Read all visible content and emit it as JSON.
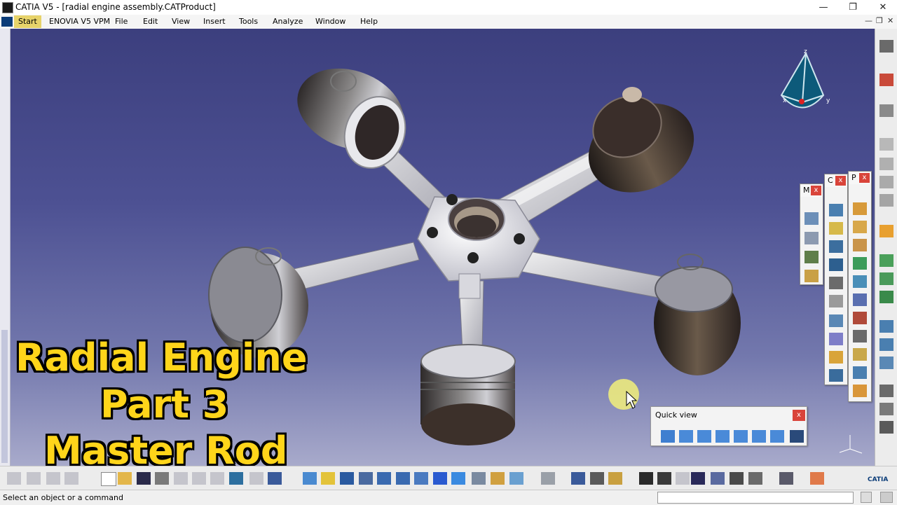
{
  "window": {
    "title": "CATIA V5 - [radial engine assembly.CATProduct]",
    "controls": [
      "—",
      "❐",
      "✕"
    ]
  },
  "menubar": {
    "start": "Start",
    "items": [
      "ENOVIA V5 VPM",
      "File",
      "Edit",
      "View",
      "Insert",
      "Tools",
      "Analyze",
      "Window",
      "Help"
    ]
  },
  "mdi_controls": [
    "—",
    "❐",
    "✕"
  ],
  "overlay": {
    "line1": "Radial Engine",
    "line2": "Part 3",
    "line3": "Master Rod"
  },
  "toolbars": {
    "m_label": "M",
    "c_label": "C",
    "p_label": "P",
    "close_glyph": "x"
  },
  "quickview": {
    "title": "Quick view",
    "close_glyph": "x"
  },
  "compass": {
    "x_label": "x",
    "y_label": "y",
    "z_label": "z"
  },
  "status": {
    "message": "Select an object or a command"
  },
  "logo": "CATIA",
  "colors": {
    "accent": "#d9443a",
    "overlay_text": "#ffd51a",
    "viewport_top": "#3c3f7e"
  }
}
